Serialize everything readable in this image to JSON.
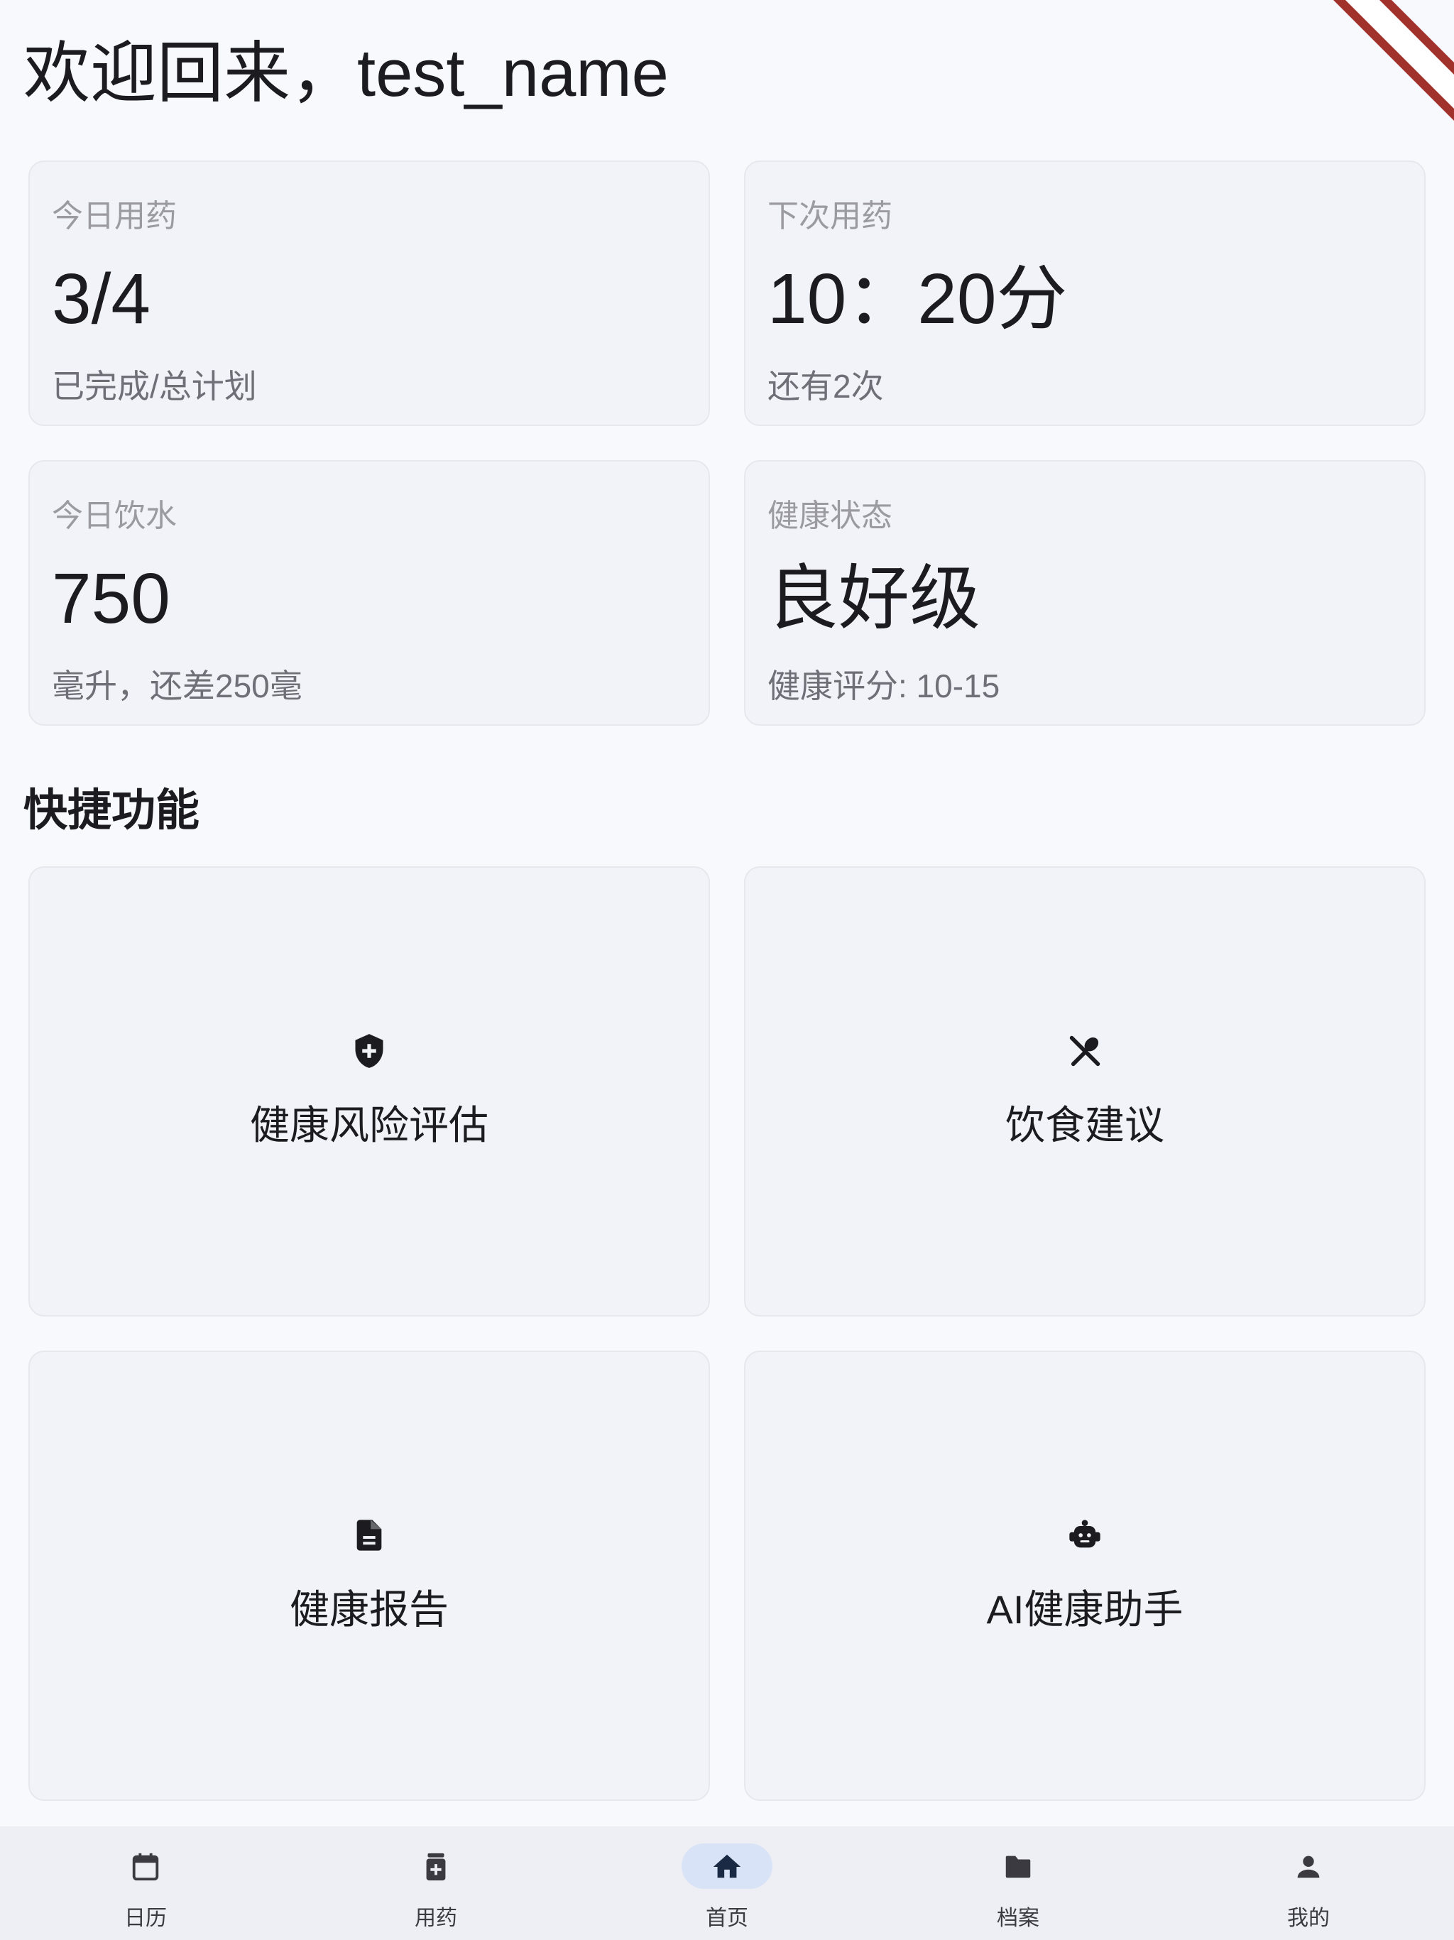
{
  "header": {
    "title": "欢迎回来，test_name"
  },
  "stats": [
    {
      "label": "今日用药",
      "value": "3/4",
      "sub": "已完成/总计划"
    },
    {
      "label": "下次用药",
      "value": "10：20分",
      "sub": "还有2次"
    },
    {
      "label": "今日饮水",
      "value": "750",
      "sub": "毫升，还差250毫"
    },
    {
      "label": "健康状态",
      "value": "良好级",
      "sub": "健康评分: 10-15"
    }
  ],
  "quick_actions": {
    "title": "快捷功能",
    "items": [
      {
        "label": "健康风险评估",
        "icon": "shield-plus-icon"
      },
      {
        "label": "饮食建议",
        "icon": "restaurant-icon"
      },
      {
        "label": "健康报告",
        "icon": "document-icon"
      },
      {
        "label": "AI健康助手",
        "icon": "robot-icon"
      }
    ]
  },
  "bottom_nav": {
    "items": [
      {
        "label": "日历",
        "icon": "calendar-icon"
      },
      {
        "label": "用药",
        "icon": "medication-icon"
      },
      {
        "label": "首页",
        "icon": "home-icon",
        "active": true
      },
      {
        "label": "档案",
        "icon": "folder-icon"
      },
      {
        "label": "我的",
        "icon": "person-icon"
      }
    ]
  },
  "colors": {
    "background": "#f7f9fc",
    "card": "#f2f3f9",
    "nav_active_pill": "#d8e3f7",
    "debug_banner": "#a0312b"
  }
}
